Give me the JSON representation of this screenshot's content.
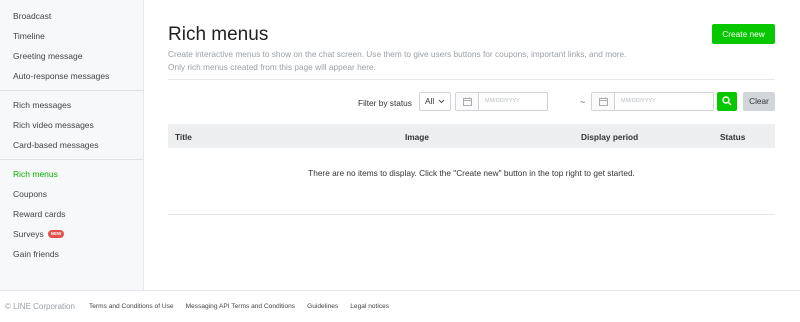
{
  "sidebar": {
    "groups": [
      [
        {
          "label": "Broadcast"
        },
        {
          "label": "Timeline"
        },
        {
          "label": "Greeting message"
        },
        {
          "label": "Auto-response messages"
        }
      ],
      [
        {
          "label": "Rich messages"
        },
        {
          "label": "Rich video messages"
        },
        {
          "label": "Card-based messages"
        }
      ],
      [
        {
          "label": "Rich menus",
          "active": true
        },
        {
          "label": "Coupons"
        },
        {
          "label": "Reward cards"
        },
        {
          "label": "Surveys",
          "badge": "NEW"
        },
        {
          "label": "Gain friends"
        }
      ]
    ]
  },
  "main": {
    "title": "Rich menus",
    "description_line1": "Create interactive menus to show on the chat screen. Use them to give users buttons for coupons, important links, and more.",
    "description_line2": "Only rich menus created from this page will appear here.",
    "create_label": "Create new"
  },
  "filter": {
    "label": "Filter by status",
    "status_value": "All",
    "date_from_placeholder": "MM/DD/YYYY",
    "date_separator": "~",
    "date_to_placeholder": "MM/DD/YYYY",
    "clear_label": "Clear"
  },
  "table": {
    "columns": [
      "Title",
      "Image",
      "Display period",
      "Status"
    ],
    "empty_message": "There are no items to display. Click the \"Create new\" button in the top right to get started."
  },
  "footer": {
    "copyright": "© LINE Corporation",
    "links": [
      "Terms and Conditions of Use",
      "Messaging API Terms and Conditions",
      "Guidelines",
      "Legal notices"
    ]
  },
  "colors": {
    "accent": "#06c700",
    "active_text": "#06b300",
    "badge": "#e4504b"
  },
  "icons": {
    "calendar": "calendar-icon",
    "search": "search-icon",
    "dropdown": "chevron-down-icon"
  }
}
